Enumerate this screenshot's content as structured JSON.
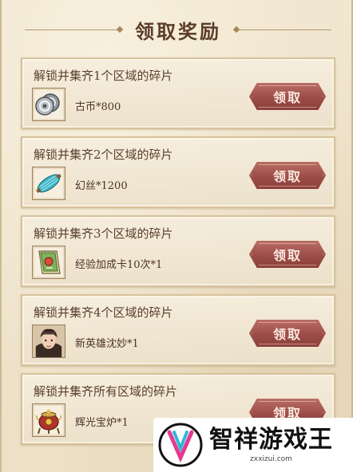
{
  "header": {
    "title": "领取奖励"
  },
  "rewards": [
    {
      "title": "解锁并集齐1个区域的碎片",
      "item_name": "古币*800",
      "item_icon": "coins-icon",
      "button_label": "领取"
    },
    {
      "title": "解锁并集齐2个区域的碎片",
      "item_name": "幻丝*1200",
      "item_icon": "silk-spool-icon",
      "button_label": "领取"
    },
    {
      "title": "解锁并集齐3个区域的碎片",
      "item_name": "经验加成卡10次*1",
      "item_icon": "exp-card-icon",
      "button_label": "领取"
    },
    {
      "title": "解锁并集齐4个区域的碎片",
      "item_name": "新英雄沈妙*1",
      "item_icon": "hero-portrait-icon",
      "button_label": "领取"
    },
    {
      "title": "解锁并集齐所有区域的碎片",
      "item_name": "辉光宝炉*1",
      "item_icon": "treasure-furnace-icon",
      "button_label": "领取"
    }
  ],
  "watermark": {
    "name": "智祥游戏王",
    "url": "zxxizui.com"
  },
  "colors": {
    "button": "#9d4d48",
    "title": "#5c3d29",
    "card_border": "#d7c29c"
  }
}
